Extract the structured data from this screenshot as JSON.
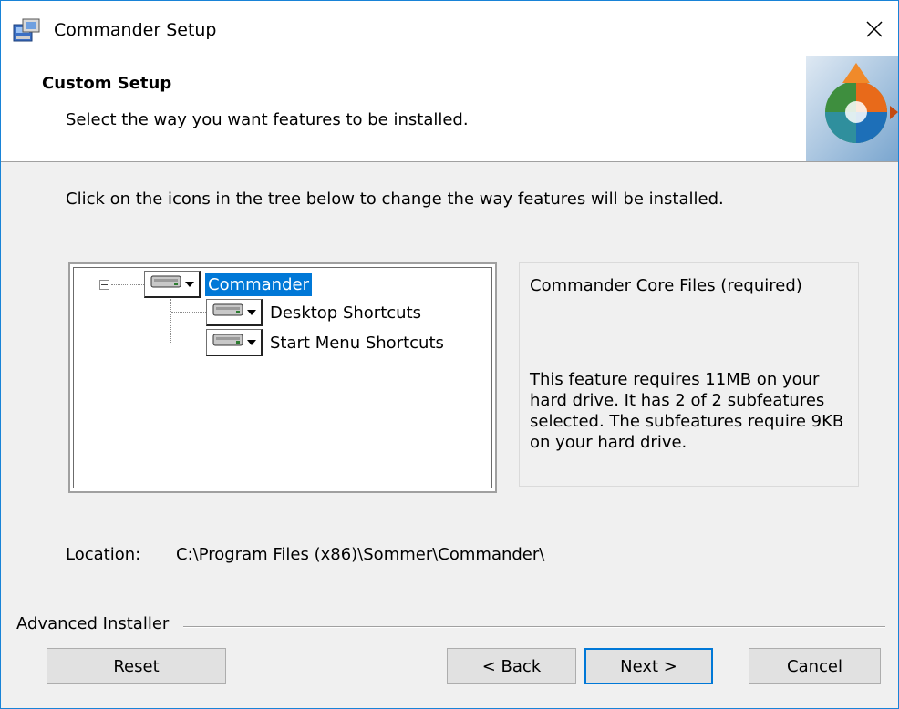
{
  "window": {
    "title": "Commander Setup",
    "close_glyph": "✕"
  },
  "header": {
    "title": "Custom Setup",
    "subtitle": "Select the way you want features to be installed.",
    "logo_icon": "installer-puzzle-logo"
  },
  "instruction": "Click on the icons in the tree below to change the way features will be installed.",
  "tree": {
    "root": {
      "label": "Commander",
      "selected": true,
      "icon": "hard-drive-icon"
    },
    "children": [
      {
        "label": "Desktop Shortcuts",
        "icon": "hard-drive-icon"
      },
      {
        "label": "Start Menu Shortcuts",
        "icon": "hard-drive-icon"
      }
    ]
  },
  "description": {
    "title": "Commander Core Files (required)",
    "body": "This feature requires 11MB on your hard drive. It has 2 of 2 subfeatures selected. The subfeatures require 9KB on your hard drive."
  },
  "location": {
    "label": "Location:",
    "path": "C:\\Program Files (x86)\\Sommer\\Commander\\"
  },
  "footer": {
    "brand": "Advanced Installer",
    "buttons": {
      "reset": "Reset",
      "back": "< Back",
      "next": "Next >",
      "cancel": "Cancel"
    }
  },
  "colors": {
    "accent": "#0078d7",
    "window_border": "#1883d7",
    "dialog_bg": "#f0f0f0"
  }
}
